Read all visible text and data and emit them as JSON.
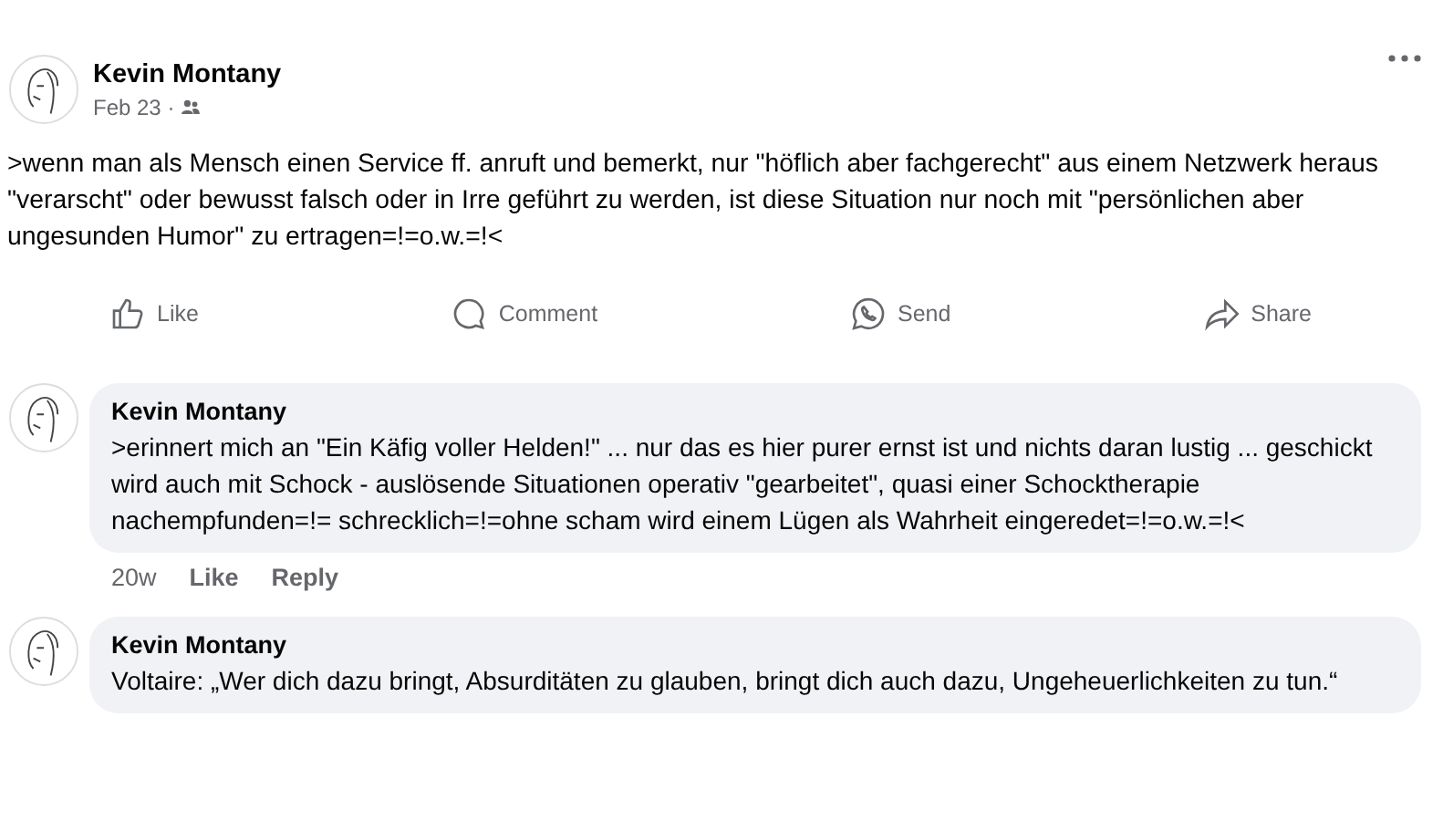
{
  "post": {
    "author": "Kevin Montany",
    "date": "Feb 23 ·",
    "text": ">wenn man als Mensch einen Service ff. anruft und bemerkt, nur \"höflich aber fachgerecht\" aus einem Netzwerk heraus \"verarscht\" oder bewusst falsch oder in Irre geführt zu werden, ist diese Situation nur noch mit \"persönlichen aber ungesunden Humor\" zu ertragen=!=o.w.=!<",
    "actions": [
      {
        "kind": "like",
        "label": "Like"
      },
      {
        "kind": "comment",
        "label": "Comment"
      },
      {
        "kind": "send",
        "label": "Send"
      },
      {
        "kind": "share",
        "label": "Share"
      }
    ]
  },
  "comments": [
    {
      "author": "Kevin Montany",
      "text": ">erinnert mich an \"Ein Käfig voller Helden!\" ... nur das es hier purer ernst ist und nichts daran lustig ... geschickt wird auch mit Schock - auslösende Situationen operativ \"gearbeitet\", quasi einer Schocktherapie nachempfunden=!= schrecklich=!=ohne scham wird einem Lügen als Wahrheit eingeredet=!=o.w.=!<",
      "time": "20w",
      "like": "Like",
      "reply": "Reply"
    },
    {
      "author": "Kevin Montany",
      "text": "Voltaire: „Wer dich dazu bringt, Absurditäten zu glauben, bringt dich auch dazu, Ungeheuerlichkeiten zu tun.“"
    }
  ]
}
